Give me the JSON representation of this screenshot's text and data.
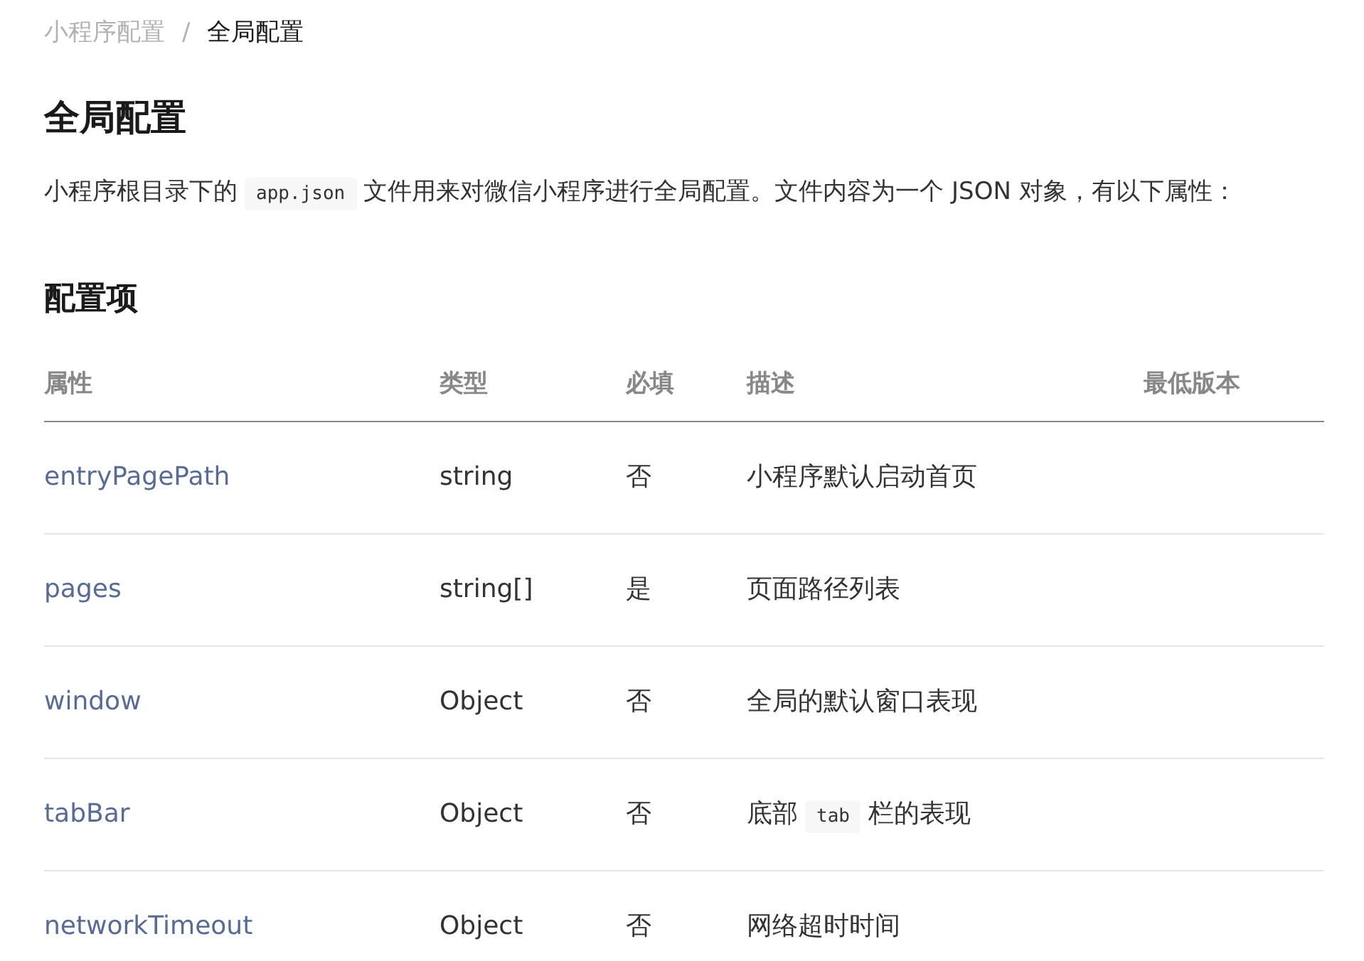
{
  "breadcrumb": [
    {
      "label": "小程序配置",
      "selected": false
    },
    {
      "label": "全局配置",
      "selected": true
    }
  ],
  "breadcrumb_separator": "/",
  "title": "全局配置",
  "intro": [
    {
      "kind": "text",
      "text": "小程序根目录下的"
    },
    {
      "kind": "code",
      "text": "app.json"
    },
    {
      "kind": "text",
      "text": "文件用来对微信小程序进行全局配置。文件内容为一个 JSON 对象，有以下属性："
    }
  ],
  "section_title": "配置项",
  "table": {
    "columns": [
      "属性",
      "类型",
      "必填",
      "描述",
      "最低版本"
    ],
    "rows": [
      {
        "property": "entryPagePath",
        "type": "string",
        "required": "否",
        "description": [
          {
            "kind": "text",
            "text": "小程序默认启动首页"
          }
        ]
      },
      {
        "property": "pages",
        "type": "string[]",
        "required": "是",
        "description": [
          {
            "kind": "text",
            "text": "页面路径列表"
          }
        ]
      },
      {
        "property": "window",
        "type": "Object",
        "required": "否",
        "description": [
          {
            "kind": "text",
            "text": "全局的默认窗口表现"
          }
        ]
      },
      {
        "property": "tabBar",
        "type": "Object",
        "required": "否",
        "description": [
          {
            "kind": "text",
            "text": "底部"
          },
          {
            "kind": "code",
            "text": "tab"
          },
          {
            "kind": "text",
            "text": "栏的表现"
          }
        ]
      },
      {
        "property": "networkTimeout",
        "type": "Object",
        "required": "否",
        "description": [
          {
            "kind": "text",
            "text": "网络超时时间"
          }
        ]
      }
    ]
  }
}
